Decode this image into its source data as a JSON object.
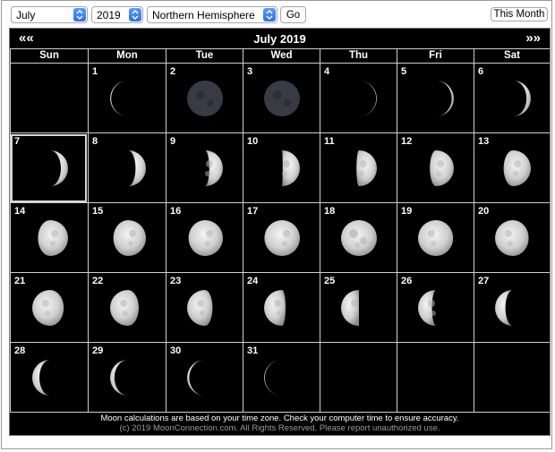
{
  "controls": {
    "month": "July",
    "year": "2019",
    "hemisphere": "Northern Hemisphere",
    "go_label": "Go",
    "this_month_label": "This Month"
  },
  "calendar": {
    "title": "July 2019",
    "prev_label": "««",
    "next_label": "»»",
    "day_names": [
      "Sun",
      "Mon",
      "Tue",
      "Wed",
      "Thu",
      "Fri",
      "Sat"
    ],
    "first_weekday": 1,
    "days_in_month": 31,
    "today": 7,
    "moon_illumination": [
      0.03,
      0.0,
      0.0,
      0.02,
      0.06,
      0.12,
      0.2,
      0.29,
      0.38,
      0.48,
      0.57,
      0.67,
      0.76,
      0.84,
      0.91,
      0.96,
      0.99,
      1.0,
      0.98,
      0.94,
      0.88,
      0.8,
      0.71,
      0.6,
      0.5,
      0.39,
      0.29,
      0.2,
      0.12,
      0.06,
      0.02
    ],
    "moon_waxing": [
      false,
      true,
      true,
      true,
      true,
      true,
      true,
      true,
      true,
      true,
      true,
      true,
      true,
      true,
      true,
      true,
      true,
      false,
      false,
      false,
      false,
      false,
      false,
      false,
      false,
      false,
      false,
      false,
      false,
      false,
      false
    ],
    "footer_line1": "Moon calculations are based on your time zone. Check your computer time to ensure accuracy.",
    "footer_line2": "(c) 2019 MoonConnection.com. All Rights Reserved. Please report unauthorized use."
  }
}
